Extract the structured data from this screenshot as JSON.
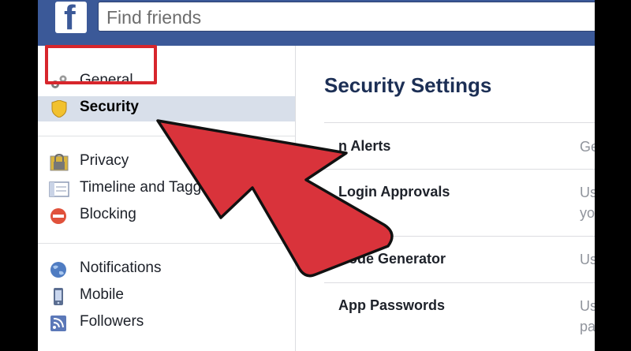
{
  "topbar": {
    "logo_letter": "f",
    "search_placeholder": "Find friends"
  },
  "sidebar": {
    "items": [
      {
        "label": "General",
        "icon": "gears-icon"
      },
      {
        "label": "Security",
        "icon": "shield-icon",
        "selected": true
      },
      {
        "label": "Privacy",
        "icon": "lock-icon"
      },
      {
        "label": "Timeline and Tagg",
        "icon": "timeline-icon"
      },
      {
        "label": "Blocking",
        "icon": "blocking-icon"
      },
      {
        "label": "Notifications",
        "icon": "globe-icon"
      },
      {
        "label": "Mobile",
        "icon": "mobile-icon"
      },
      {
        "label": "Followers",
        "icon": "rss-icon"
      }
    ]
  },
  "main": {
    "title": "Security Settings",
    "rows": [
      {
        "label": "n Alerts",
        "value_line1": "Ge",
        "value_line2": ""
      },
      {
        "label": "Login Approvals",
        "value_line1": "Us",
        "value_line2": "yo"
      },
      {
        "label": "Code Generator",
        "value_line1": "Us",
        "value_line2": ""
      },
      {
        "label": "App Passwords",
        "value_line1": "Us",
        "value_line2": "pa"
      }
    ]
  },
  "colors": {
    "brand": "#3b5998",
    "annotation_red": "#d7262c",
    "selected_bg": "#d8dfea"
  }
}
